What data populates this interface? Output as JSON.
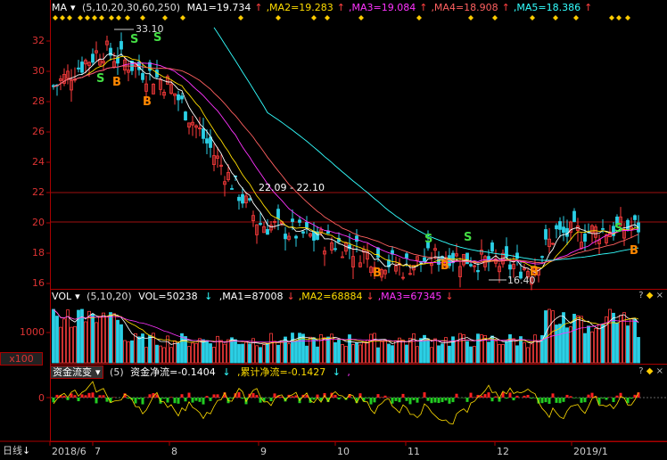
{
  "main_header": {
    "indicator": "MA",
    "params": "(5,10,20,30,60,250)",
    "ma": [
      {
        "label": "MA1=19.734",
        "color": "#ffffff"
      },
      {
        "label": ",MA2=19.283",
        "color": "#ffdd00"
      },
      {
        "label": ",MA3=19.084",
        "color": "#ff33ff"
      },
      {
        "label": ",MA4=18.908",
        "color": "#ff6060"
      },
      {
        "label": ",MA5=18.386",
        "color": "#33ffff"
      }
    ],
    "arrow": "↑"
  },
  "vol_header": {
    "indicator": "VOL",
    "params": "(5,10,20)",
    "vol": "VOL=50238",
    "ma": [
      {
        "label": ",MA1=87008",
        "color": "#ffffff"
      },
      {
        "label": ",MA2=68884",
        "color": "#ffdd00"
      },
      {
        "label": ",MA3=67345",
        "color": "#ff33ff"
      }
    ],
    "arrow": "↓"
  },
  "fund_header": {
    "indicator": "资金流变",
    "params": "(5)",
    "net": "资金净流=-0.1404",
    "cum": ",累计净流=-0.1427",
    "arrow": "↓",
    "tail": ","
  },
  "controls": {
    "help": "?",
    "settings": "◆",
    "close": "×"
  },
  "bottom_bar": {
    "period": "日线",
    "period_arrow": "↓"
  },
  "price_axis": [
    "32",
    "30",
    "28",
    "26",
    "24",
    "22",
    "20",
    "18",
    "16"
  ],
  "vol_axis": {
    "tick": "1000",
    "unit": "x100"
  },
  "fund_axis": {
    "tick": "0"
  },
  "x_labels": [
    "2018/6",
    "7",
    "8",
    "9",
    "10",
    "11",
    "12",
    "2019/1"
  ],
  "annotations": {
    "high": "33.10",
    "low": "16.40",
    "range": "22.09 - 22.10",
    "buy": "B",
    "sell": "S"
  },
  "colors": {
    "up": "#ff3c3c",
    "down": "#2bd0e6",
    "ma1": "#ffffff",
    "ma2": "#ffdd00",
    "ma3": "#ff33ff",
    "ma4": "#ff6060",
    "ma5": "#33ffff",
    "axis": "#aa0000",
    "fund_pos": "#ff2020",
    "fund_neg": "#22cc22",
    "signal": "#ffcc00"
  }
}
